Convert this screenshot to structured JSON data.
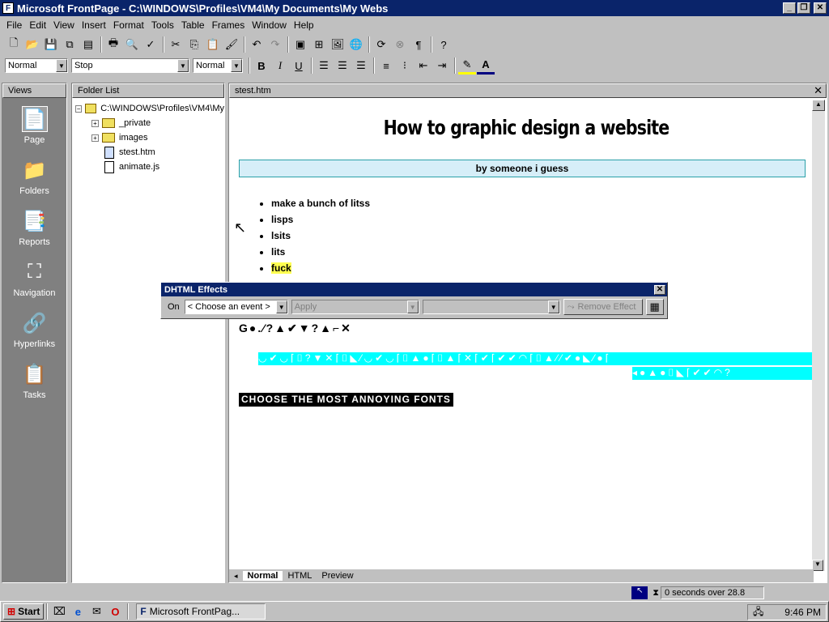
{
  "window": {
    "title": "Microsoft FrontPage - C:\\WINDOWS\\Profiles\\VM4\\My Documents\\My Webs"
  },
  "menu": [
    "File",
    "Edit",
    "View",
    "Insert",
    "Format",
    "Tools",
    "Table",
    "Frames",
    "Window",
    "Help"
  ],
  "format_toolbar": {
    "style": "Normal",
    "font": "Stop",
    "size": "Normal"
  },
  "views": {
    "header": "Views",
    "items": [
      {
        "label": "Page",
        "icon": "page-icon"
      },
      {
        "label": "Folders",
        "icon": "folders-icon"
      },
      {
        "label": "Reports",
        "icon": "reports-icon"
      },
      {
        "label": "Navigation",
        "icon": "navigation-icon"
      },
      {
        "label": "Hyperlinks",
        "icon": "hyperlinks-icon"
      },
      {
        "label": "Tasks",
        "icon": "tasks-icon"
      }
    ]
  },
  "folder_list": {
    "header": "Folder List",
    "root": "C:\\WINDOWS\\Profiles\\VM4\\My",
    "items": [
      {
        "label": "_private",
        "type": "folder"
      },
      {
        "label": "images",
        "type": "folder"
      },
      {
        "label": "stest.htm",
        "type": "page"
      },
      {
        "label": "animate.js",
        "type": "file"
      }
    ]
  },
  "editor": {
    "tab": "stest.htm",
    "title": "How to graphic design a website",
    "byline": "by someone i guess",
    "bullets": [
      "make a bunch of litss",
      "lisps",
      "lsits",
      "lits",
      "fuck"
    ],
    "glyph_row": "G●.⁄?▲✔▼?▲⌐✕",
    "cyan_line_1": "◡✔◡⌈⌷?▼✕⌈⌷◣⁄◡✔◡⌈⌷▲●⌈⌷▲⌈✕⌈✔⌈✔✔◠⌈⌷▲⁄⁄✔●◣⁄●⌈",
    "cyan_line_2": "◂●▲●⌷◣⌈✔✔◠?",
    "annoying": "CHOOSE THE MOST ANNOYING FONTS",
    "tabs": [
      "Normal",
      "HTML",
      "Preview"
    ]
  },
  "dhtml": {
    "title": "DHTML Effects",
    "on_label": "On",
    "event": "< Choose an event >",
    "apply": "Apply",
    "remove": "Remove Effect"
  },
  "status": {
    "text": "0 seconds over 28.8"
  },
  "taskbar": {
    "start": "Start",
    "task": "Microsoft FrontPag...",
    "clock": "9:46 PM"
  }
}
